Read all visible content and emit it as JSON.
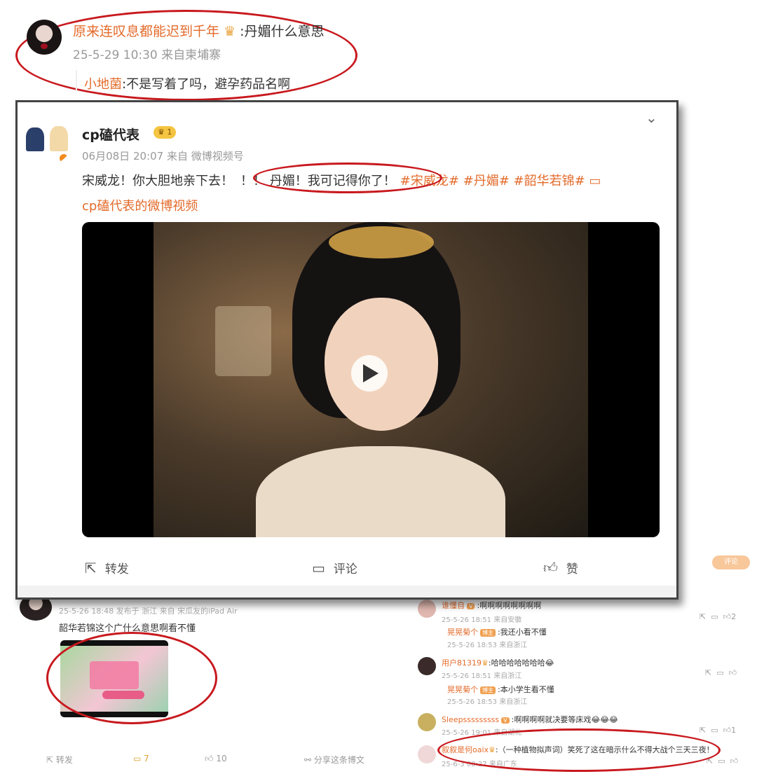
{
  "top_comment": {
    "username": "原来连叹息都能迟到千年",
    "text": ":丹媚什么意思",
    "meta": "25-5-29 10:30 来自柬埔寨",
    "reply_user": "小地菌",
    "reply_text": ":不是写着了吗，避孕药品名啊"
  },
  "card": {
    "author": "cp磕代表",
    "level": "1",
    "meta": "06月08日 20:07 来自 微博视频号",
    "text_before": "宋威龙！你大胆地亲下去！",
    "text_circled": "！！ 丹媚！我可记得你了！",
    "hashtags": "#宋威龙# #丹媚# #韶华若锦#",
    "video_link": "cp磕代表的微博视频",
    "actions": {
      "repost": "转发",
      "comment": "评论",
      "like": "赞"
    }
  },
  "bottom_left": {
    "meta": "25-5-26 18:48 发布于 浙江 来自 宋瓜友的iPad Air",
    "text": "韶华若锦这个广什么意思啊看不懂",
    "repost": "转发",
    "comments": "7",
    "likes": "10",
    "share": "分享这条博文"
  },
  "side_badge": "评论",
  "comments": [
    {
      "user": "谁懂自",
      "text": ":啊啊啊啊啊啊啊啊",
      "meta": "25-5-26 18:51 来自安徽",
      "count": "2",
      "reply_user": "晃晃菊个",
      "reply_text": ":我还小看不懂",
      "reply_meta": "25-5-26 18:53 来自浙江"
    },
    {
      "user": "用户81319",
      "text": ":哈哈哈哈哈哈哈",
      "meta": "25-5-26 18:51 来自浙江",
      "count": "",
      "reply_user": "晃晃菊个",
      "reply_text": ":本小学生看不懂",
      "reply_meta": "25-5-26 18:53 来自浙江"
    },
    {
      "user": "Sleepsssssssss",
      "text": ":啊啊啊啊就决要等床戏",
      "meta": "25-5-26 19:01 来自湖北",
      "count": "1"
    },
    {
      "user": "叙叙是何oaix",
      "text": ":（一种植物拟声词）笑死了这在暗示什么不得大战个三天三夜！",
      "meta": "25-6-3 00:27 来自广东",
      "count": ""
    }
  ]
}
